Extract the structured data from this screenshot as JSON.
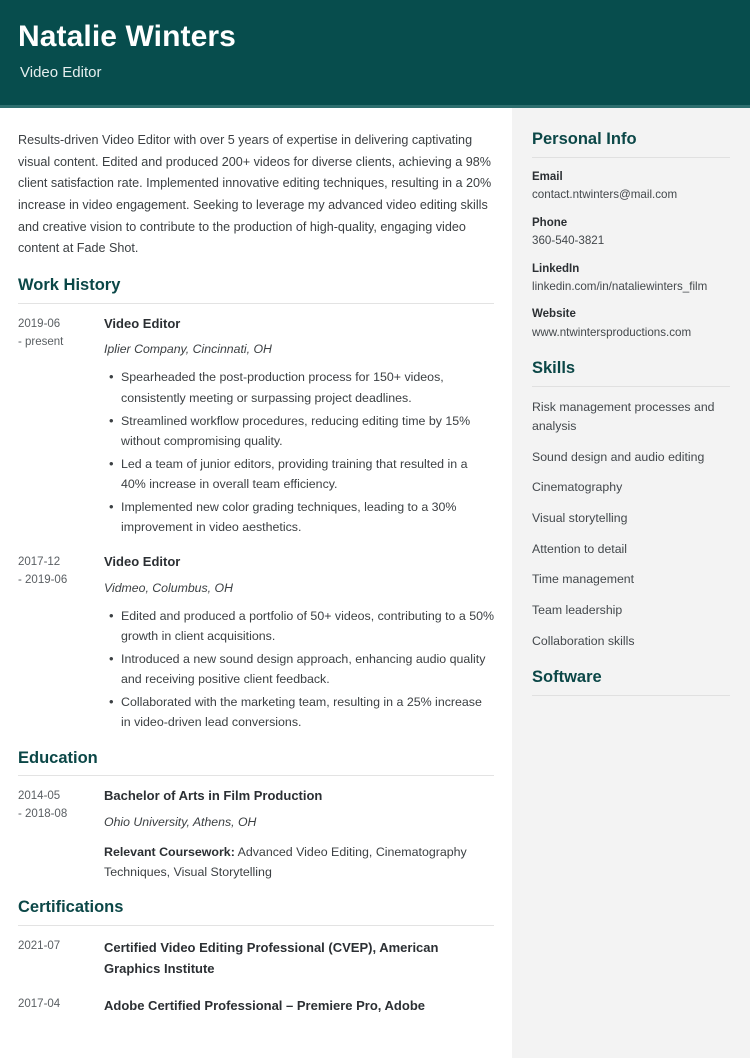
{
  "header": {
    "name": "Natalie Winters",
    "job_title": "Video Editor",
    "background_color": "#074d4d",
    "accent_rule_color": "#2d6e6e"
  },
  "theme": {
    "heading_color": "#0b4747",
    "sidebar_background": "#f3f3f3",
    "body_text_color": "#3c4043"
  },
  "main": {
    "summary": "Results-driven Video Editor with over 5 years of expertise in delivering captivating visual content. Edited and produced 200+ videos for diverse clients, achieving a 98% client satisfaction rate. Implemented innovative editing techniques, resulting in a 20% increase in video engagement. Seeking to leverage my advanced video editing skills and creative vision to contribute to the production of high-quality, engaging video content at Fade Shot.",
    "work_history": {
      "heading": "Work History",
      "entries": [
        {
          "date_start": "2019-06",
          "date_end": "- present",
          "role": "Video Editor",
          "organization": "Iplier Company, Cincinnati, OH",
          "bullets": [
            "Spearheaded the post-production process for 150+ videos, consistently meeting or surpassing project deadlines.",
            "Streamlined workflow procedures, reducing editing time by 15% without compromising quality.",
            "Led a team of junior editors, providing training that resulted in a 40% increase in overall team efficiency.",
            "Implemented new color grading techniques, leading to a 30% improvement in video aesthetics."
          ]
        },
        {
          "date_start": "2017-12",
          "date_end": "- 2019-06",
          "role": "Video Editor",
          "organization": "Vidmeo, Columbus, OH",
          "bullets": [
            "Edited and produced a portfolio of 50+ videos, contributing to a 50% growth in client acquisitions.",
            "Introduced a new sound design approach, enhancing audio quality and receiving positive client feedback.",
            "Collaborated with the marketing team, resulting in a 25% increase in video-driven lead conversions."
          ]
        }
      ]
    },
    "education": {
      "heading": "Education",
      "entries": [
        {
          "date_start": "2014-05",
          "date_end": "- 2018-08",
          "degree": "Bachelor of Arts in Film Production",
          "institution": "Ohio University, Athens, OH",
          "coursework_label": "Relevant Coursework:",
          "coursework_value": " Advanced Video Editing, Cinematography Techniques, Visual Storytelling"
        }
      ]
    },
    "certifications": {
      "heading": "Certifications",
      "entries": [
        {
          "date": "2021-07",
          "title": "Certified Video Editing Professional (CVEP), American Graphics Institute"
        },
        {
          "date": "2017-04",
          "title": "Adobe Certified Professional – Premiere Pro, Adobe"
        }
      ]
    }
  },
  "sidebar": {
    "personal_info": {
      "heading": "Personal Info",
      "items": [
        {
          "label": "Email",
          "value": "contact.ntwinters@mail.com"
        },
        {
          "label": "Phone",
          "value": "360-540-3821"
        },
        {
          "label": "LinkedIn",
          "value": "linkedin.com/in/nataliewinters_film"
        },
        {
          "label": "Website",
          "value": "www.ntwintersproductions.com"
        }
      ]
    },
    "skills": {
      "heading": "Skills",
      "items": [
        "Risk management processes and analysis",
        "Sound design and audio editing",
        "Cinematography",
        "Visual storytelling",
        "Attention to detail",
        "Time management",
        "Team leadership",
        "Collaboration skills"
      ]
    },
    "software": {
      "heading": "Software",
      "items": []
    }
  }
}
